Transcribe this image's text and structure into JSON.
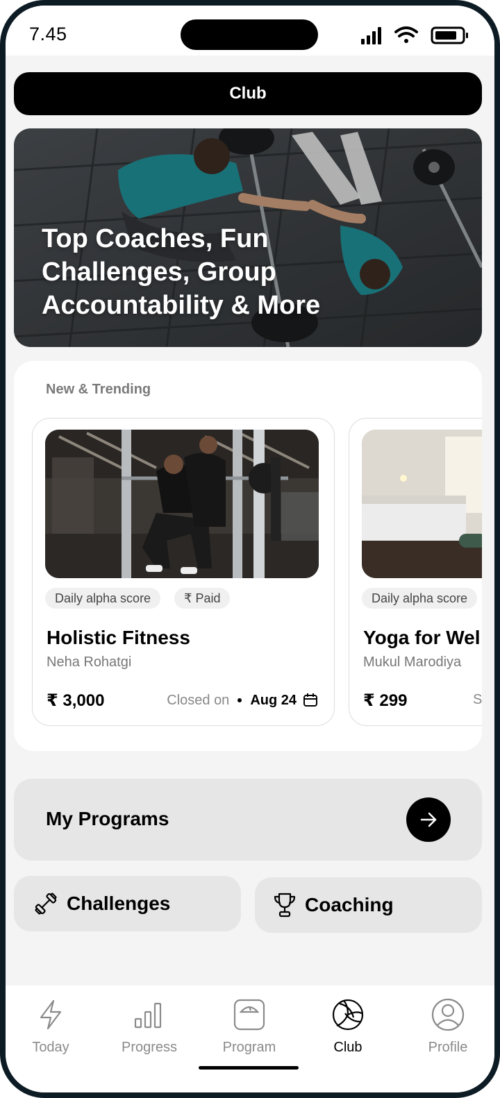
{
  "status_bar": {
    "time": "7.45"
  },
  "header": {
    "title": "Club"
  },
  "hero": {
    "headline": "Top Coaches, Fun Challenges, Group Accountability & More"
  },
  "trending": {
    "title": "New & Trending",
    "cards": [
      {
        "title": "Holistic Fitness",
        "author": "Neha Rohatgi",
        "tags": [
          "Daily alpha score",
          "₹ Paid"
        ],
        "price": "₹ 3,000",
        "status": "Closed on",
        "date": "Aug 24"
      },
      {
        "title": "Yoga for Wel",
        "author": "Mukul Marodiya",
        "tags": [
          "Daily alpha score"
        ],
        "price": "₹ 299",
        "status": "S"
      }
    ]
  },
  "my_programs": {
    "label": "My Programs"
  },
  "tiles": [
    {
      "label": "Challenges",
      "icon": "dumbbell-icon"
    },
    {
      "label": "Coaching",
      "icon": "trophy-icon"
    }
  ],
  "tabs": [
    {
      "label": "Today",
      "icon": "lightning-icon"
    },
    {
      "label": "Progress",
      "icon": "bar-chart-icon"
    },
    {
      "label": "Program",
      "icon": "scale-icon"
    },
    {
      "label": "Club",
      "icon": "volleyball-icon",
      "active": true
    },
    {
      "label": "Profile",
      "icon": "user-icon"
    }
  ],
  "colors": {
    "primary": "#000000",
    "background": "#f4f4f4",
    "tile": "#e6e6e6",
    "muted": "#8a8a8a"
  }
}
